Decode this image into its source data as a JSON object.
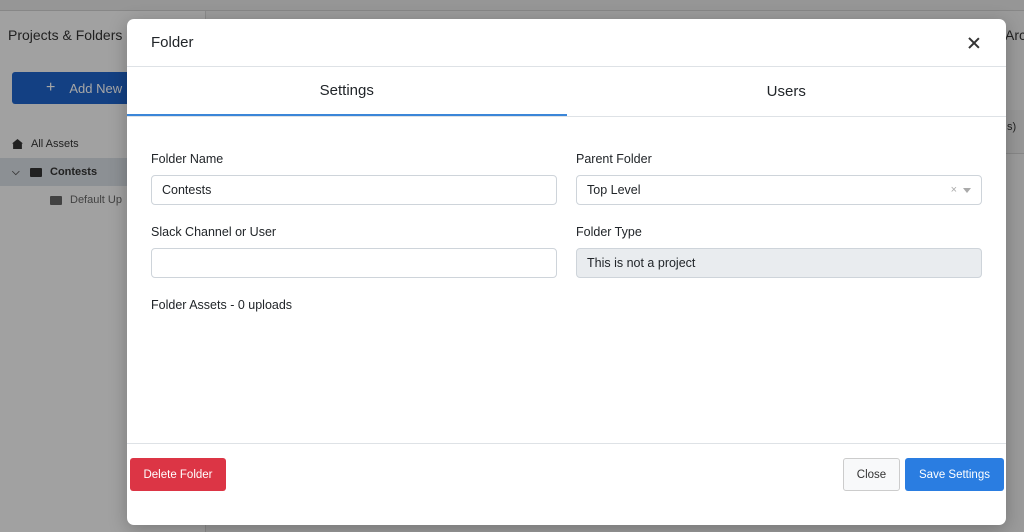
{
  "background": {
    "sidebar_title": "Projects & Folders",
    "add_new_label": "Add New",
    "tree": [
      {
        "label": "All Assets"
      },
      {
        "label": "Contests"
      },
      {
        "label": "Default Up"
      }
    ],
    "right_title": "Arc",
    "right_label": "s)"
  },
  "modal": {
    "title": "Folder",
    "tabs": [
      {
        "label": "Settings",
        "active": true
      },
      {
        "label": "Users",
        "active": false
      }
    ],
    "fields": {
      "folder_name": {
        "label": "Folder Name",
        "value": "Contests"
      },
      "parent_folder": {
        "label": "Parent Folder",
        "value": "Top Level",
        "clear_glyph": "×"
      },
      "slack": {
        "label": "Slack Channel or User",
        "value": ""
      },
      "folder_type": {
        "label": "Folder Type",
        "value": "This is not a project"
      }
    },
    "assets_text": "Folder Assets - 0 uploads",
    "footer": {
      "delete_label": "Delete Folder",
      "close_label": "Close",
      "save_label": "Save Settings"
    }
  },
  "colors": {
    "primary": "#2a7de1",
    "danger": "#dc3545",
    "tab_active_border": "#3b86d8"
  }
}
